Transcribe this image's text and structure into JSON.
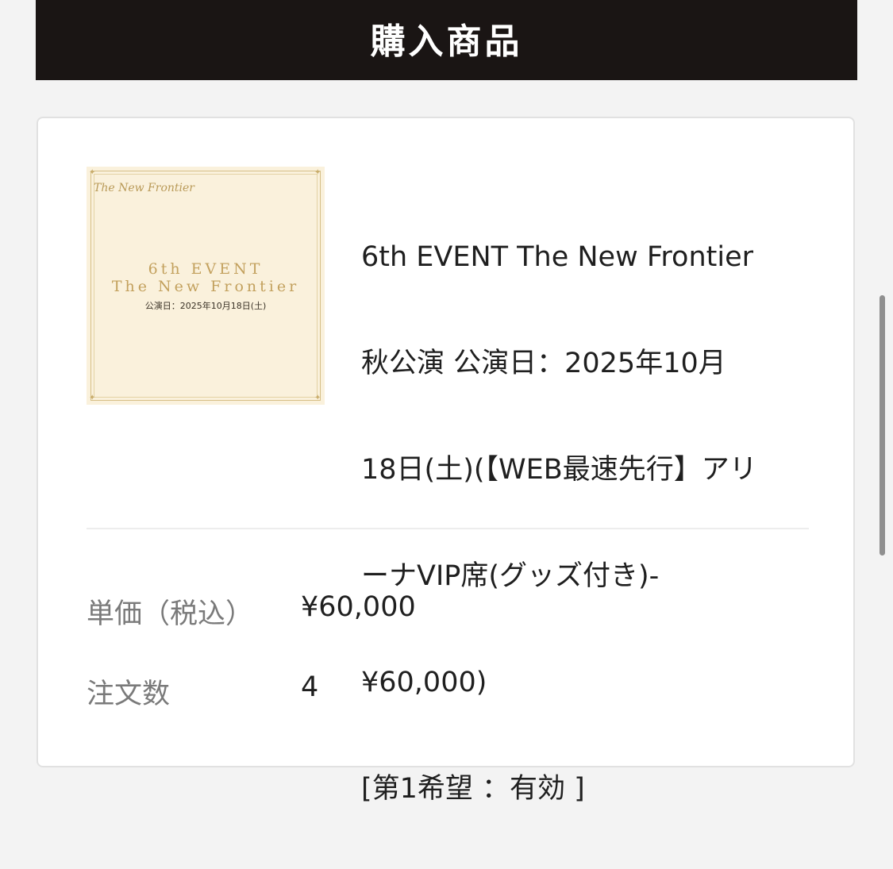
{
  "header": {
    "title": "購入商品"
  },
  "product": {
    "thumbnail": {
      "logo": "The New Frontier",
      "line1": "6th EVENT",
      "line2": "The New Frontier",
      "line3": "公演日：2025年10月18日(土)"
    },
    "name_lines": [
      "6th EVENT The New Frontier",
      "秋公演 公演日：2025年10月",
      "18日(土)(【WEB最速先行】アリ",
      "ーナVIP席(グッズ付き)-",
      "¥60,000)",
      "[第1希望 ：有効 ]"
    ]
  },
  "details": {
    "price_label": "単価（税込）",
    "price_value": "¥60,000",
    "qty_label": "注文数",
    "qty_value": "4"
  },
  "colors": {
    "header_bg": "#1a1514",
    "thumbnail_bg": "#faf1dc",
    "thumbnail_gold": "#c3a15e"
  }
}
